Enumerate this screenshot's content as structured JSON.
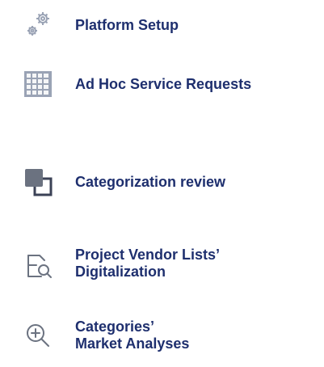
{
  "menu": {
    "items": [
      {
        "label": "Platform Setup",
        "icon": "gears-icon"
      },
      {
        "label": "Ad Hoc Service Requests",
        "icon": "keypad-grid-icon"
      },
      {
        "label": "Categorization review",
        "icon": "overlapping-squares-icon"
      },
      {
        "label": "Project Vendor Lists’\nDigitalization",
        "icon": "document-search-icon"
      },
      {
        "label": "Categories’\nMarket Analyses",
        "icon": "zoom-in-icon"
      }
    ]
  },
  "colors": {
    "label": "#1e2f6e",
    "icon_dark": "#3b4256",
    "icon_light": "#9aa3b5",
    "icon_stroke": "#6b7280"
  }
}
